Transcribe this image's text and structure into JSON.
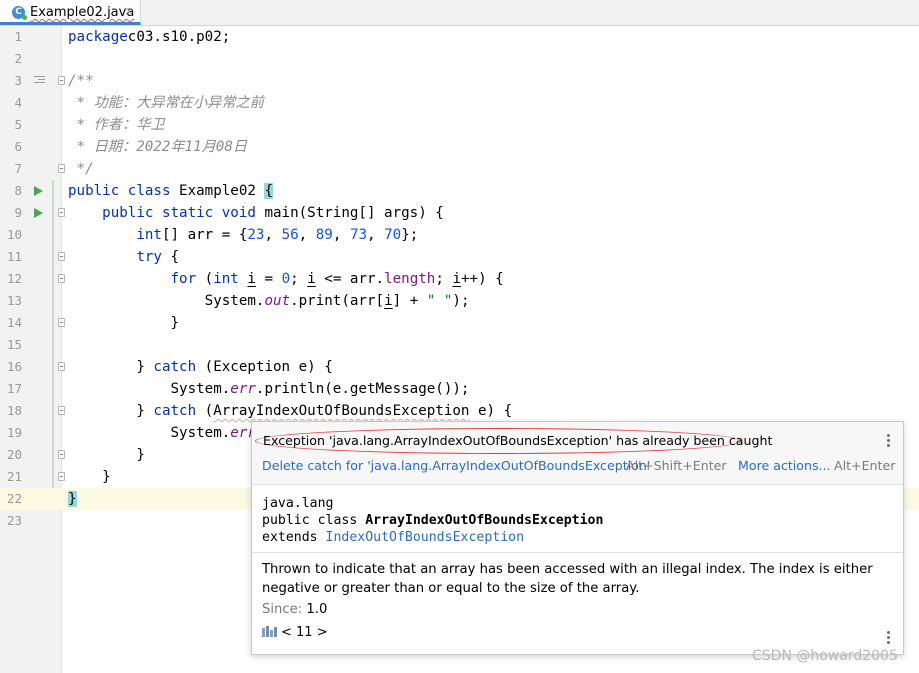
{
  "tab": {
    "filename": "Example02.java",
    "close_glyph": "×",
    "icon": "java-class-icon"
  },
  "editor": {
    "current_line": 22,
    "lines": [
      {
        "n": "1",
        "tokens": [
          [
            "kw",
            "package"
          ],
          [
            "",
            "c03.s10.p02;"
          ]
        ]
      },
      {
        "n": "2",
        "tokens": []
      },
      {
        "n": "3",
        "tokens": [
          [
            "doc",
            "/**"
          ]
        ],
        "gutter": "doc-toggle",
        "fold": true
      },
      {
        "n": "4",
        "tokens": [
          [
            "doc",
            " * 功能：大异常在小异常之前"
          ]
        ]
      },
      {
        "n": "5",
        "tokens": [
          [
            "doc",
            " * 作者：华卫"
          ]
        ]
      },
      {
        "n": "6",
        "tokens": [
          [
            "doc",
            " * 日期：2022年11月08日"
          ]
        ]
      },
      {
        "n": "7",
        "tokens": [
          [
            "doc",
            " */"
          ]
        ],
        "fold": true
      },
      {
        "n": "8",
        "tokens": [
          [
            "kw",
            "public class "
          ],
          [
            "",
            "Example02 "
          ],
          [
            "brace-hl",
            "{"
          ]
        ],
        "gutter": "run"
      },
      {
        "n": "9",
        "tokens": [
          [
            "kw",
            "    public static void "
          ],
          [
            "",
            "main(String[] args) {"
          ]
        ],
        "gutter": "run",
        "fold": true
      },
      {
        "n": "10",
        "tokens": [
          [
            "kw",
            "        int"
          ],
          [
            "",
            "[] arr = {"
          ],
          [
            "num",
            "23"
          ],
          [
            "",
            ", "
          ],
          [
            "num",
            "56"
          ],
          [
            "",
            ", "
          ],
          [
            "num",
            "89"
          ],
          [
            "",
            ", "
          ],
          [
            "num",
            "73"
          ],
          [
            "",
            ", "
          ],
          [
            "num",
            "70"
          ],
          [
            "",
            "};"
          ]
        ]
      },
      {
        "n": "11",
        "tokens": [
          [
            "kw",
            "        try "
          ],
          [
            "",
            "{"
          ]
        ],
        "fold": true
      },
      {
        "n": "12",
        "tokens": [
          [
            "kw",
            "            for "
          ],
          [
            "",
            "("
          ],
          [
            "kw",
            "int "
          ],
          [
            "ul",
            "i"
          ],
          [
            "",
            " = "
          ],
          [
            "num",
            "0"
          ],
          [
            "",
            "; "
          ],
          [
            "ul",
            "i"
          ],
          [
            "",
            " <= arr."
          ],
          [
            "fld",
            "length"
          ],
          [
            "",
            "; "
          ],
          [
            "ul",
            "i"
          ],
          [
            "",
            "++) {"
          ]
        ],
        "fold": true
      },
      {
        "n": "13",
        "tokens": [
          [
            "",
            "                System."
          ],
          [
            "sfld",
            "out"
          ],
          [
            "",
            ".print(arr["
          ],
          [
            "ul",
            "i"
          ],
          [
            "",
            "] + "
          ],
          [
            "str",
            "\" \""
          ],
          [
            "",
            ");"
          ]
        ]
      },
      {
        "n": "14",
        "tokens": [
          [
            "",
            "            }"
          ]
        ],
        "fold": true
      },
      {
        "n": "15",
        "tokens": []
      },
      {
        "n": "16",
        "tokens": [
          [
            "",
            "        } "
          ],
          [
            "kw",
            "catch "
          ],
          [
            "",
            "(Exception e) {"
          ]
        ],
        "fold": true
      },
      {
        "n": "17",
        "tokens": [
          [
            "",
            "            System."
          ],
          [
            "sfld",
            "err"
          ],
          [
            "",
            ".println(e.getMessage());"
          ]
        ]
      },
      {
        "n": "18",
        "tokens": [
          [
            "",
            "        } "
          ],
          [
            "kw",
            "catch "
          ],
          [
            "",
            "("
          ],
          [
            "err-ul",
            "ArrayIndexOutOfBoundsException"
          ],
          [
            "",
            " e) {"
          ]
        ],
        "fold": true
      },
      {
        "n": "19",
        "tokens": [
          [
            "",
            "            System."
          ],
          [
            "sfld",
            "err"
          ]
        ]
      },
      {
        "n": "20",
        "tokens": [
          [
            "",
            "        }"
          ]
        ],
        "fold": true
      },
      {
        "n": "21",
        "tokens": [
          [
            "",
            "    }"
          ]
        ],
        "fold": true
      },
      {
        "n": "22",
        "tokens": [
          [
            "brace-hl",
            "}"
          ]
        ]
      },
      {
        "n": "23",
        "tokens": []
      }
    ]
  },
  "popup": {
    "problem_text": "Exception 'java.lang.ArrayIndexOutOfBoundsException' has already been caught",
    "fix_action": "Delete catch for 'java.lang.ArrayIndexOutOfBoundsException'",
    "fix_shortcut": "Alt+Shift+Enter",
    "more_actions": "More actions...",
    "more_shortcut": "Alt+Enter",
    "decl_package": "java.lang",
    "decl_class_prefix": "public class ",
    "decl_class_name": "ArrayIndexOutOfBoundsException",
    "decl_extends_prefix": "extends ",
    "decl_extends": "IndexOutOfBoundsException",
    "description": "Thrown to indicate that an array has been accessed with an illegal index. The index is either negative or greater than or equal to the size of the array.",
    "since_label": "Since:",
    "since_value": "1.0",
    "jdk_label": "< 11 >"
  },
  "watermark": "CSDN @howard2005",
  "colors": {
    "keyword": "#0033b3",
    "number": "#1750eb",
    "string": "#067d17",
    "field": "#871094",
    "run": "#4aa64f",
    "highlight_oval": "#e23b3b"
  }
}
